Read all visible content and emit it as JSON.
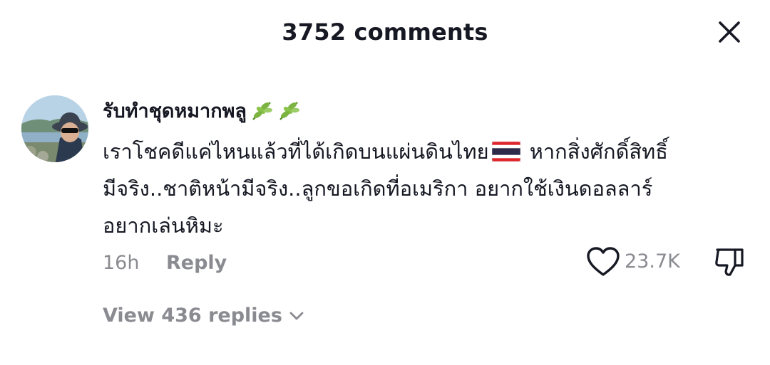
{
  "header": {
    "title": "3752 comments",
    "close_icon": "close-icon"
  },
  "comment": {
    "username": "รับทำชุดหมากพลู",
    "username_emoji": [
      "herb-icon",
      "herb-icon"
    ],
    "text_lines": [
      "เราโชคดีแค่ไหนแล้วที่ได้เกิดบนแผ่นดินไทย",
      "หากสิ่งศักดิ์สิทธิ์",
      "มีจริง..ชาติหน้ามีจริง..ลูกขอเกิดที่อเมริกา อยากใช้เงินดอลลาร์",
      "อยากเล่นหิมะ"
    ],
    "flag_icon": "thailand-flag-icon",
    "time": "16h",
    "reply_label": "Reply",
    "like_count": "23.7K",
    "like_icon": "heart-outline-icon",
    "dislike_icon": "thumbs-down-icon",
    "view_replies_label": "View 436 replies"
  },
  "colors": {
    "text_primary": "#161823",
    "text_secondary": "#8a8b91",
    "background": "#ffffff"
  }
}
